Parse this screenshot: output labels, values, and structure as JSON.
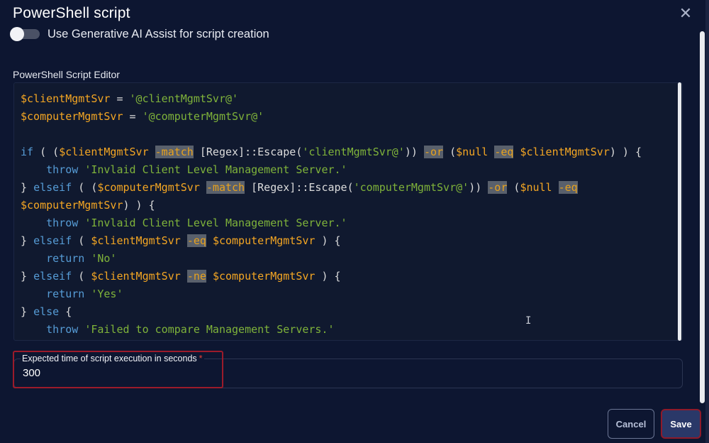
{
  "dialog": {
    "title": "PowerShell script",
    "close_icon": "close-icon"
  },
  "toggle": {
    "label": "Use Generative AI Assist for script creation",
    "state": "off"
  },
  "editor": {
    "label": "PowerShell Script Editor",
    "lines": [
      [
        {
          "c": "v",
          "t": "$clientMgmtSvr"
        },
        {
          "c": "t",
          "t": " = "
        },
        {
          "c": "s",
          "t": "'@clientMgmtSvr@'"
        }
      ],
      [
        {
          "c": "v",
          "t": "$computerMgmtSvr"
        },
        {
          "c": "t",
          "t": " = "
        },
        {
          "c": "s",
          "t": "'@computerMgmtSvr@'"
        }
      ],
      [],
      [
        {
          "c": "k",
          "t": "if"
        },
        {
          "c": "t",
          "t": " ( ("
        },
        {
          "c": "v",
          "t": "$clientMgmtSvr"
        },
        {
          "c": "t",
          "t": " "
        },
        {
          "c": "op",
          "t": "-match"
        },
        {
          "c": "t",
          "t": " [Regex]::Escape("
        },
        {
          "c": "s",
          "t": "'clientMgmtSvr@'"
        },
        {
          "c": "t",
          "t": ")) "
        },
        {
          "c": "op",
          "t": "-or"
        },
        {
          "c": "t",
          "t": " ("
        },
        {
          "c": "v",
          "t": "$null"
        },
        {
          "c": "t",
          "t": " "
        },
        {
          "c": "op",
          "t": "-eq"
        },
        {
          "c": "t",
          "t": " "
        },
        {
          "c": "v",
          "t": "$clientMgmtSvr"
        },
        {
          "c": "t",
          "t": ") ) {"
        }
      ],
      [
        {
          "c": "t",
          "t": "    "
        },
        {
          "c": "k",
          "t": "throw"
        },
        {
          "c": "t",
          "t": " "
        },
        {
          "c": "s",
          "t": "'Invlaid Client Level Management Server.'"
        }
      ],
      [
        {
          "c": "t",
          "t": "} "
        },
        {
          "c": "k",
          "t": "elseif"
        },
        {
          "c": "t",
          "t": " ( ("
        },
        {
          "c": "v",
          "t": "$computerMgmtSvr"
        },
        {
          "c": "t",
          "t": " "
        },
        {
          "c": "op",
          "t": "-match"
        },
        {
          "c": "t",
          "t": " [Regex]::Escape("
        },
        {
          "c": "s",
          "t": "'computerMgmtSvr@'"
        },
        {
          "c": "t",
          "t": ")) "
        },
        {
          "c": "op",
          "t": "-or"
        },
        {
          "c": "t",
          "t": " ("
        },
        {
          "c": "v",
          "t": "$null"
        },
        {
          "c": "t",
          "t": " "
        },
        {
          "c": "op",
          "t": "-eq"
        }
      ],
      [
        {
          "c": "v",
          "t": "$computerMgmtSvr"
        },
        {
          "c": "t",
          "t": ") ) {"
        }
      ],
      [
        {
          "c": "t",
          "t": "    "
        },
        {
          "c": "k",
          "t": "throw"
        },
        {
          "c": "t",
          "t": " "
        },
        {
          "c": "s",
          "t": "'Invlaid Client Level Management Server.'"
        }
      ],
      [
        {
          "c": "t",
          "t": "} "
        },
        {
          "c": "k",
          "t": "elseif"
        },
        {
          "c": "t",
          "t": " ( "
        },
        {
          "c": "v",
          "t": "$clientMgmtSvr"
        },
        {
          "c": "t",
          "t": " "
        },
        {
          "c": "op",
          "t": "-eq"
        },
        {
          "c": "t",
          "t": " "
        },
        {
          "c": "v",
          "t": "$computerMgmtSvr"
        },
        {
          "c": "t",
          "t": " ) {"
        }
      ],
      [
        {
          "c": "t",
          "t": "    "
        },
        {
          "c": "k",
          "t": "return"
        },
        {
          "c": "t",
          "t": " "
        },
        {
          "c": "s",
          "t": "'No'"
        }
      ],
      [
        {
          "c": "t",
          "t": "} "
        },
        {
          "c": "k",
          "t": "elseif"
        },
        {
          "c": "t",
          "t": " ( "
        },
        {
          "c": "v",
          "t": "$clientMgmtSvr"
        },
        {
          "c": "t",
          "t": " "
        },
        {
          "c": "op",
          "t": "-ne"
        },
        {
          "c": "t",
          "t": " "
        },
        {
          "c": "v",
          "t": "$computerMgmtSvr"
        },
        {
          "c": "t",
          "t": " ) {"
        }
      ],
      [
        {
          "c": "t",
          "t": "    "
        },
        {
          "c": "k",
          "t": "return"
        },
        {
          "c": "t",
          "t": " "
        },
        {
          "c": "s",
          "t": "'Yes'"
        }
      ],
      [
        {
          "c": "t",
          "t": "} "
        },
        {
          "c": "k",
          "t": "else"
        },
        {
          "c": "t",
          "t": " {"
        }
      ],
      [
        {
          "c": "t",
          "t": "    "
        },
        {
          "c": "k",
          "t": "throw"
        },
        {
          "c": "t",
          "t": " "
        },
        {
          "c": "s",
          "t": "'Failed to compare Management Servers.'"
        }
      ]
    ]
  },
  "execution_time": {
    "label": "Expected time of script execution in seconds",
    "required_mark": "*",
    "value": "300"
  },
  "footer": {
    "cancel_label": "Cancel",
    "save_label": "Save"
  },
  "colors": {
    "background": "#0d1631",
    "variable": "#f4a623",
    "string": "#7fb33a",
    "keyword": "#569cd6",
    "highlight": "#9b1b2a"
  }
}
